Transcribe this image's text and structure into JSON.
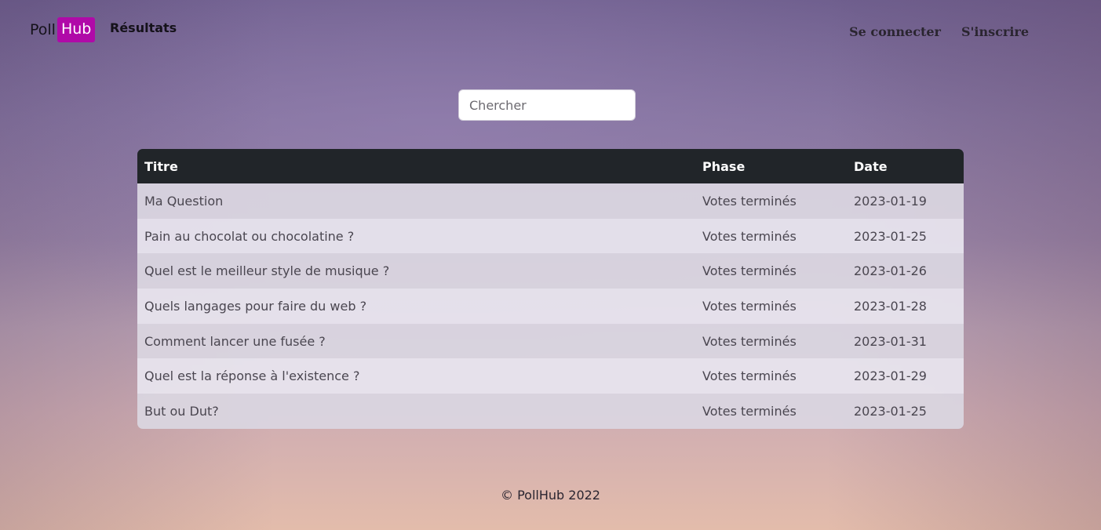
{
  "brand": {
    "part1": "Poll",
    "part2": "Hub",
    "accent_color": "#b00aa8"
  },
  "nav": {
    "results": "Résultats",
    "login": "Se connecter",
    "register": "S'inscrire"
  },
  "search": {
    "placeholder": "Chercher",
    "value": ""
  },
  "table": {
    "headers": {
      "title": "Titre",
      "phase": "Phase",
      "date": "Date"
    },
    "rows": [
      {
        "title": "Ma Question",
        "phase": "Votes terminés",
        "date": "2023-01-19"
      },
      {
        "title": "Pain au chocolat ou chocolatine ?",
        "phase": "Votes terminés",
        "date": "2023-01-25"
      },
      {
        "title": "Quel est le meilleur style de musique ?",
        "phase": "Votes terminés",
        "date": "2023-01-26"
      },
      {
        "title": "Quels langages pour faire du web ?",
        "phase": "Votes terminés",
        "date": "2023-01-28"
      },
      {
        "title": "Comment lancer une fusée ?",
        "phase": "Votes terminés",
        "date": "2023-01-31"
      },
      {
        "title": "Quel est la réponse à l'existence ?",
        "phase": "Votes terminés",
        "date": "2023-01-29"
      },
      {
        "title": "But ou Dut?",
        "phase": "Votes terminés",
        "date": "2023-01-25"
      }
    ]
  },
  "footer": {
    "text": "© PollHub 2022"
  }
}
